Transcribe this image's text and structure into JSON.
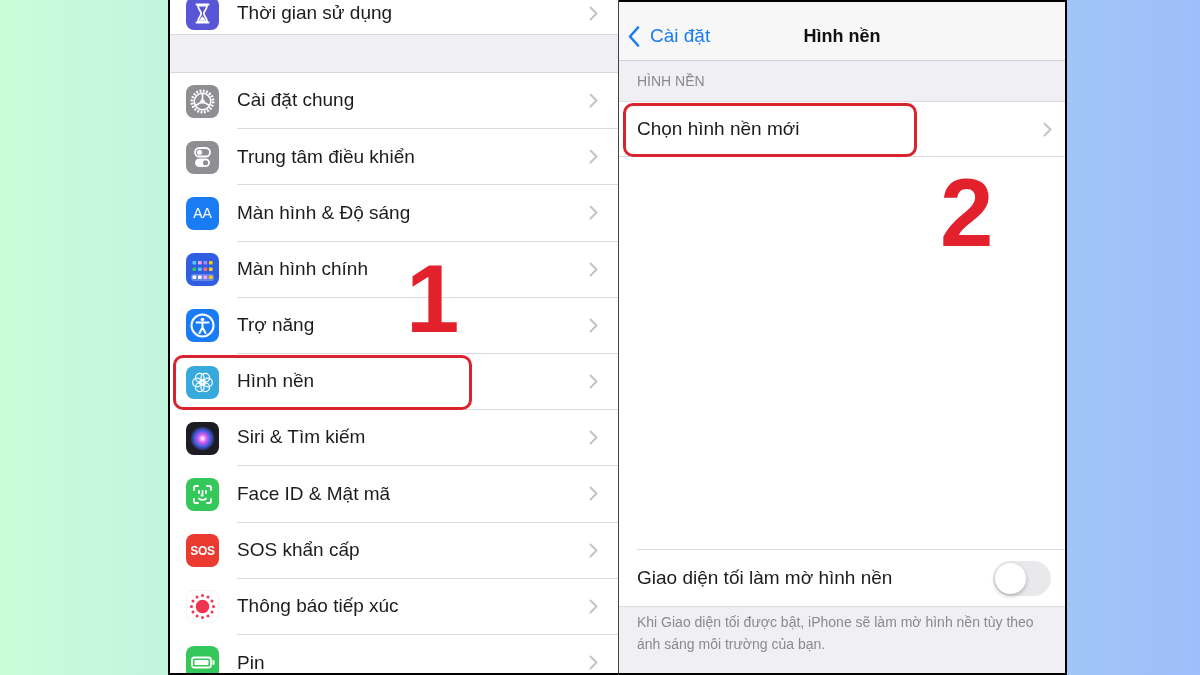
{
  "settings_screen": {
    "groups": [
      {
        "items": [
          {
            "label": "Thời gian sử dụng",
            "highlighted": false
          }
        ]
      },
      {
        "items": [
          {
            "label": "Cài đặt chung",
            "highlighted": false
          },
          {
            "label": "Trung tâm điều khiển",
            "highlighted": false
          },
          {
            "label": "Màn hình & Độ sáng",
            "icon_text": "AA",
            "highlighted": false
          },
          {
            "label": "Màn hình chính",
            "highlighted": false
          },
          {
            "label": "Trợ năng",
            "highlighted": false
          },
          {
            "label": "Hình nền",
            "highlighted": true
          },
          {
            "label": "Siri & Tìm kiếm",
            "highlighted": false
          },
          {
            "label": "Face ID & Mật mã",
            "highlighted": false
          },
          {
            "label": "SOS khẩn cấp",
            "icon_text": "SOS",
            "highlighted": false
          },
          {
            "label": "Thông báo tiếp xúc",
            "highlighted": false
          },
          {
            "label": "Pin",
            "highlighted": false
          }
        ]
      }
    ],
    "step_number": "1"
  },
  "wallpaper_screen": {
    "nav_bar": {
      "back_label": "Cài đặt",
      "title": "Hình nền"
    },
    "section_header": "HÌNH NỀN",
    "rows": [
      {
        "label": "Chọn hình nền mới",
        "highlighted": true
      }
    ],
    "step_number": "2",
    "toggle_row": {
      "label": "Giao diện tối làm mờ hình nền",
      "on": false
    },
    "footer_note": "Khi Giao diện tối được bật, iPhone sẽ làm mờ hình nền tùy theo ánh sáng môi trường của bạn."
  }
}
